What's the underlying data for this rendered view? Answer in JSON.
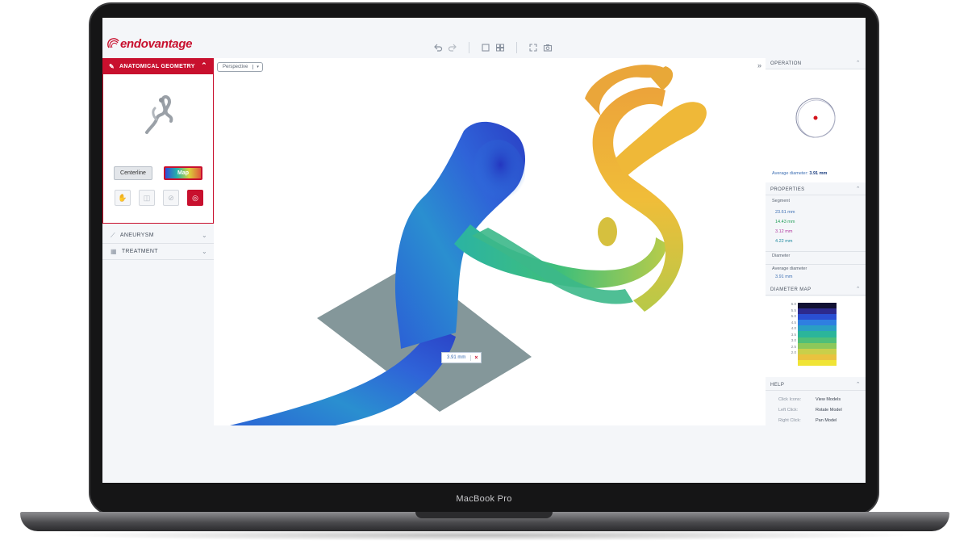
{
  "device": {
    "label": "MacBook Pro"
  },
  "app": {
    "logo_text": "endovantage"
  },
  "toolbar": {
    "icons": [
      "undo-icon",
      "redo-icon",
      "single-view-icon",
      "split-view-icon",
      "fullscreen-icon",
      "camera-icon"
    ]
  },
  "left_panel": {
    "anatomical_geometry": {
      "title": "ANATOMICAL GEOMETRY",
      "centerline_label": "Centerline",
      "map_label": "Map"
    },
    "sections": [
      {
        "title": "ANEURYSM"
      },
      {
        "title": "TREATMENT"
      }
    ]
  },
  "viewport": {
    "projection": "Perspective",
    "measurement": "3.91 mm"
  },
  "right_panel": {
    "operation": {
      "title": "OPERATION",
      "avg_label": "Average diameter:",
      "avg_value": "3.91 mm"
    },
    "properties": {
      "title": "PROPERTIES",
      "segment_label": "Segment",
      "segments": [
        {
          "value": "23.61 mm",
          "color": "#3d6fb3"
        },
        {
          "value": "14.43 mm",
          "color": "#1f9e57"
        },
        {
          "value": "3.12 mm",
          "color": "#b0379f"
        },
        {
          "value": "4.22 mm",
          "color": "#1f8aa0"
        }
      ],
      "diameter_label": "Diameter",
      "avg_diameter_label": "Average diameter",
      "avg_diameter_value": "3.91 mm"
    },
    "diameter_map": {
      "title": "DIAMETER MAP",
      "ticks": [
        "6.0",
        "5.5",
        "5.0",
        "4.5",
        "4.0",
        "3.5",
        "3.0",
        "2.5",
        "2.0"
      ],
      "colors": [
        "#111133",
        "#2d2a8e",
        "#2a4fd3",
        "#2f7fe0",
        "#2a9fc3",
        "#2bb59a",
        "#4fbf78",
        "#8cc85a",
        "#c9cf4a",
        "#e9c23f",
        "#f0e436"
      ]
    },
    "help": {
      "title": "HELP",
      "rows": [
        {
          "key": "Click Icons:",
          "value": "View Models"
        },
        {
          "key": "Left Click:",
          "value": "Rotate Model"
        },
        {
          "key": "Right Click:",
          "value": "Pan Model"
        }
      ]
    }
  }
}
